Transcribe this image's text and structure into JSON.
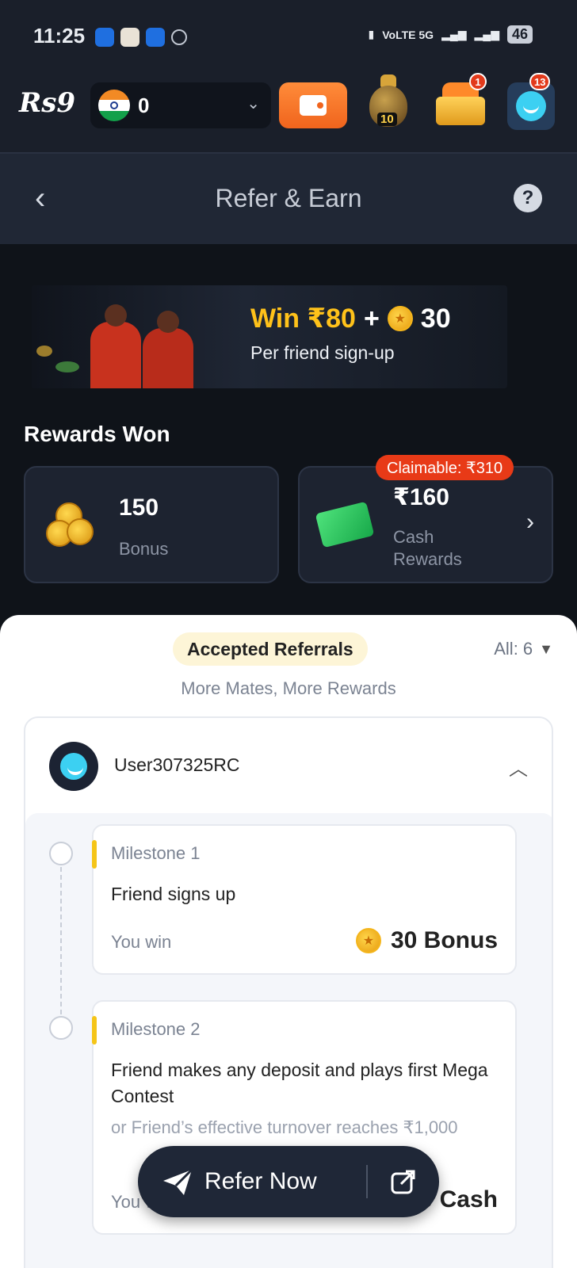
{
  "status_bar": {
    "time": "11:25",
    "network": "VoLTE 5G",
    "battery": "46"
  },
  "header": {
    "logo": "Rs9",
    "balance": "0",
    "pot_level": "10",
    "chest_badge": "1",
    "avatar_badge": "13"
  },
  "titlebar": {
    "title": "Refer & Earn",
    "help": "?"
  },
  "banner": {
    "win_amount": "Win ₹80",
    "plus": "+",
    "coin_amount": "30",
    "subtitle": "Per friend sign-up"
  },
  "rewards": {
    "heading": "Rewards Won",
    "bonus_value": "150",
    "bonus_label": "Bonus",
    "cash_value": "₹160",
    "cash_label": "Cash Rewards",
    "claimable": "Claimable: ₹310"
  },
  "referrals": {
    "tab_label": "Accepted Referrals",
    "all_count": "All: 6",
    "subtitle": "More Mates, More Rewards",
    "user_name": "User307325RC",
    "milestones": [
      {
        "title": "Milestone 1",
        "desc": "Friend signs up",
        "win_label": "You win",
        "prize": "30 Bonus"
      },
      {
        "title": "Milestone 2",
        "desc": "Friend makes any deposit and plays first Mega Contest",
        "alt": "or Friend’s effective turnover reaches ₹1,000",
        "win_label": "You win",
        "prize": "₹80 Cash"
      }
    ]
  },
  "refer_button": {
    "label": "Refer Now"
  },
  "colors": {
    "accent": "#f0641d",
    "gold": "#ffc21a",
    "claim_red": "#e83a17",
    "sheet_bg": "#ffffff"
  }
}
